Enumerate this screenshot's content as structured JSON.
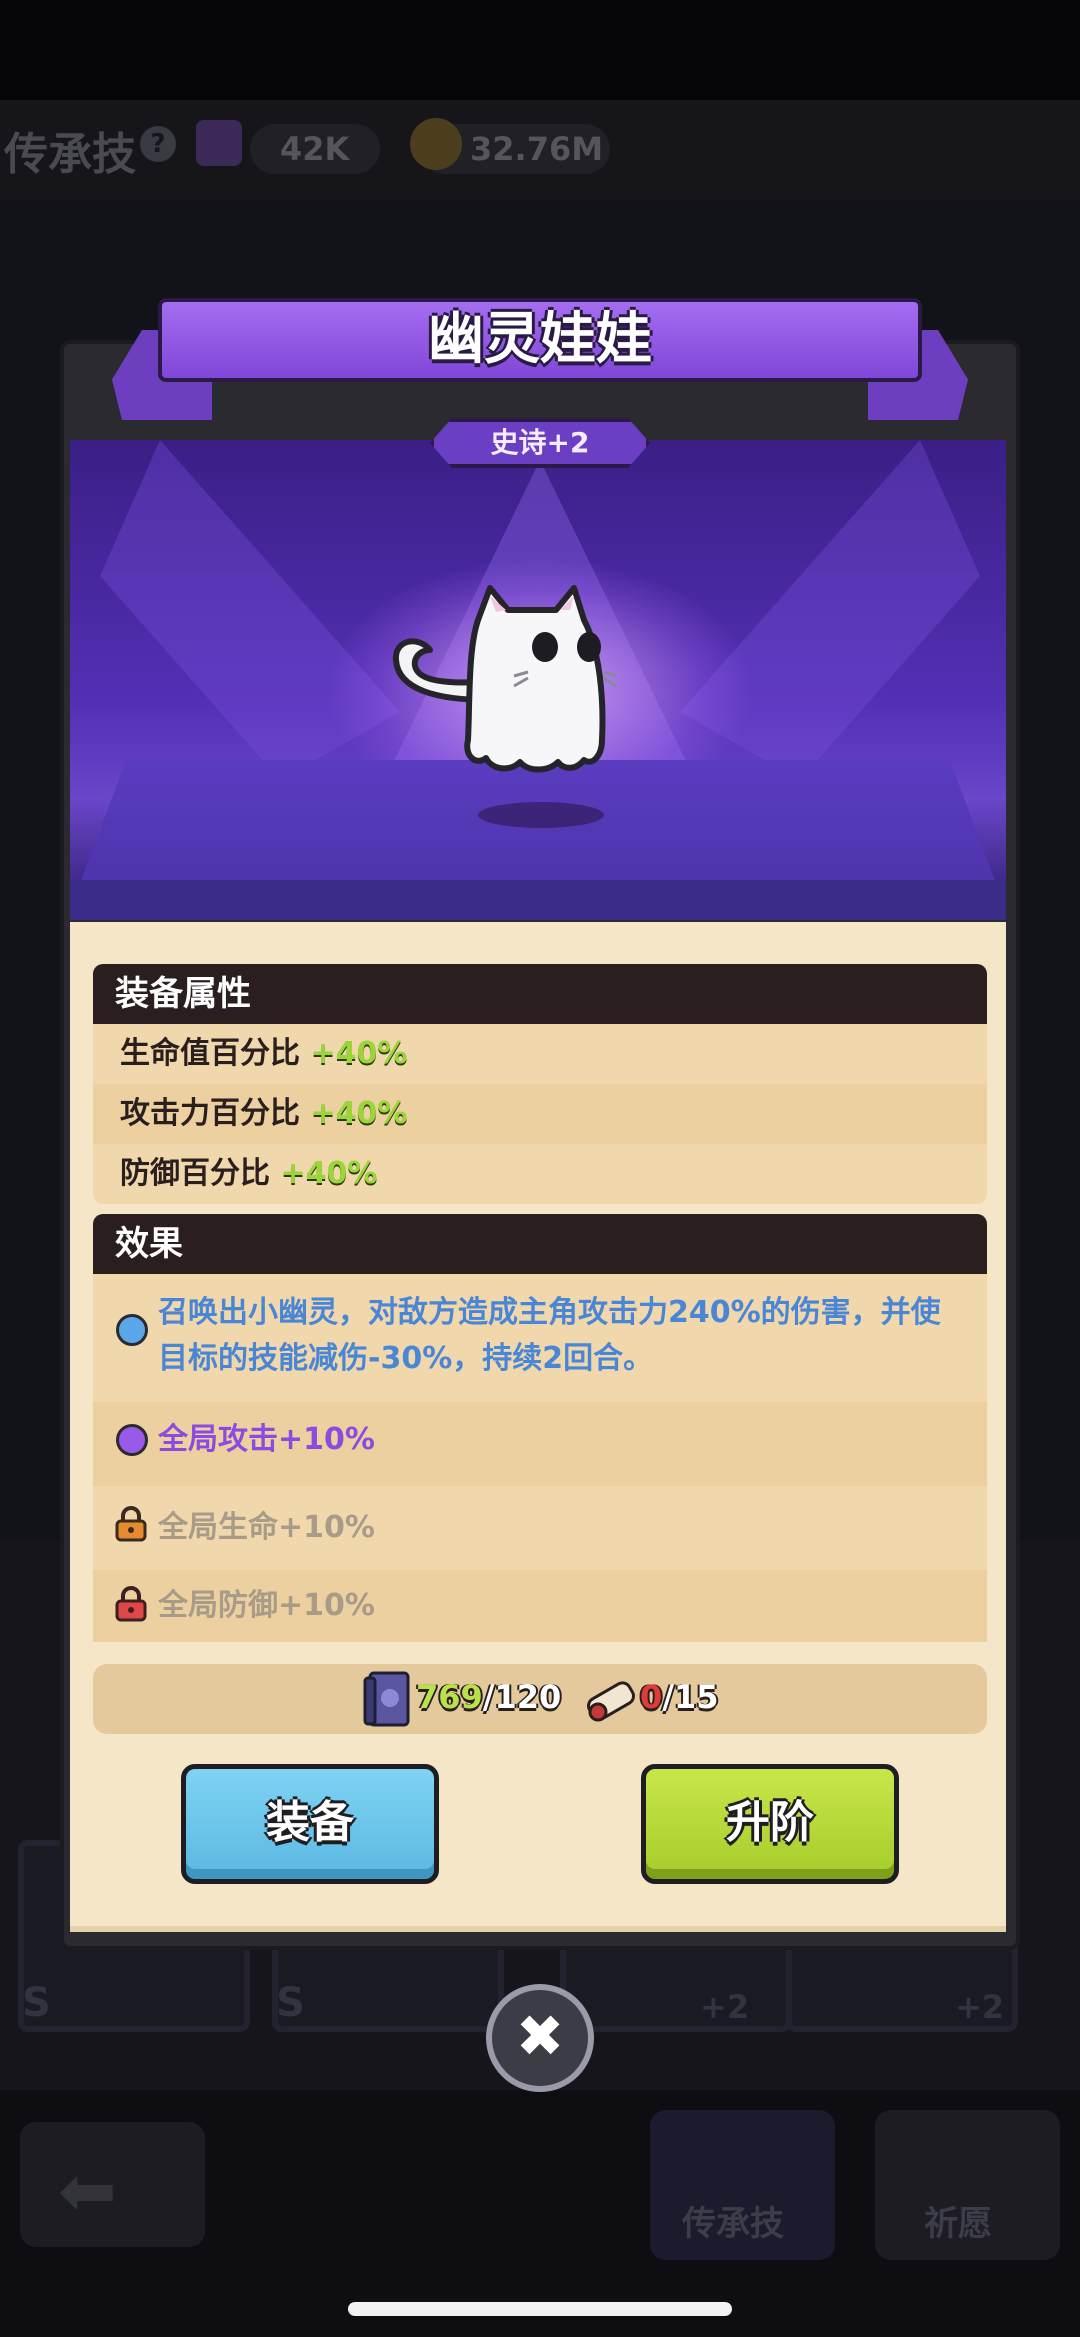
{
  "header": {
    "title": "传承技",
    "help_icon": "question-icon",
    "gems_value": "42K",
    "coins_value": "32.76M"
  },
  "background": {
    "card_labels": [
      "S",
      "S"
    ],
    "card_plus": [
      "+2",
      "+2"
    ],
    "nav": {
      "heritage_label": "传承技",
      "wish_label": "祈愿"
    }
  },
  "modal": {
    "title": "幽灵娃娃",
    "rarity": "史诗+2",
    "attributes": {
      "title": "装备属性",
      "rows": [
        {
          "label": "生命值百分比",
          "value": "+40%"
        },
        {
          "label": "攻击力百分比",
          "value": "+40%"
        },
        {
          "label": "防御百分比",
          "value": "+40%"
        }
      ]
    },
    "effects": {
      "title": "效果",
      "items": [
        {
          "text": "召唤出小幽灵，对敌方造成主角攻击力240%的伤害，并使目标的技能减伤-30%，持续2回合。",
          "state": "active",
          "color": "#4a86d6"
        },
        {
          "text": "全局攻击+10%",
          "state": "active",
          "color": "#8b4be0"
        },
        {
          "text": "全局生命+10%",
          "state": "locked",
          "color": "#a89c88"
        },
        {
          "text": "全局防御+10%",
          "state": "locked",
          "color": "#a89c88"
        }
      ]
    },
    "cost": {
      "book_have": "769",
      "book_need": "/120",
      "scroll_have": "0",
      "scroll_need": "/15"
    },
    "buttons": {
      "equip": "装备",
      "upgrade": "升阶"
    }
  },
  "colors": {
    "ribbon": "#8e55e6",
    "equip_button": "#6cc6ec",
    "upgrade_button": "#b7da37",
    "attr_value": "#9bd53a"
  }
}
